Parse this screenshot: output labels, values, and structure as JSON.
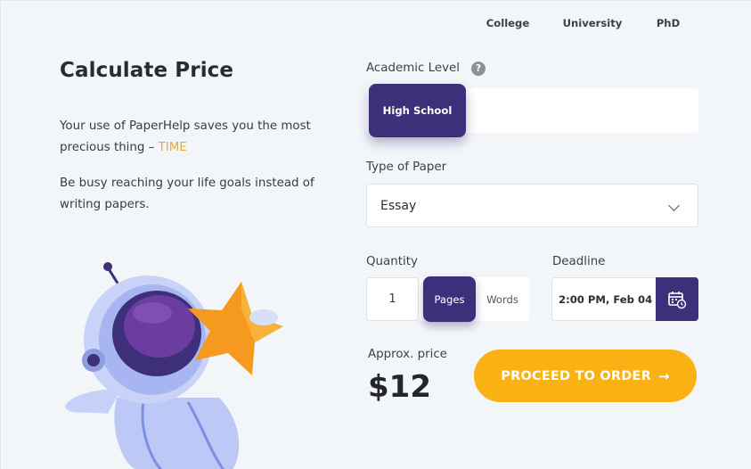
{
  "left": {
    "title": "Calculate Price",
    "para1_prefix": "Your use of PaperHelp saves you the most precious thing – ",
    "para1_accent": "TIME",
    "para2": "Be busy reaching your life goals instead of writing papers."
  },
  "form": {
    "academic_label": "Academic Level",
    "help_glyph": "?",
    "levels": [
      "High School",
      "College",
      "University",
      "PhD"
    ],
    "selected_level": "High School",
    "paper_label": "Type of Paper",
    "paper_value": "Essay",
    "quantity_label": "Quantity",
    "quantity_value": "1",
    "units": [
      "Pages",
      "Words"
    ],
    "selected_unit": "Pages",
    "deadline_label": "Deadline",
    "deadline_value": "2:00 PM, Feb 04",
    "approx_label": "Approx. price",
    "price": "$12",
    "proceed_label": "PROCEED TO ORDER",
    "proceed_arrow": "→"
  },
  "colors": {
    "primary": "#3e2f7a",
    "accent": "#f9b114",
    "background": "#f3f6f9"
  },
  "icons": {
    "help": "help-icon",
    "chevron": "chevron-down-icon",
    "calendar": "calendar-icon",
    "illustration": "astronaut-illustration"
  }
}
